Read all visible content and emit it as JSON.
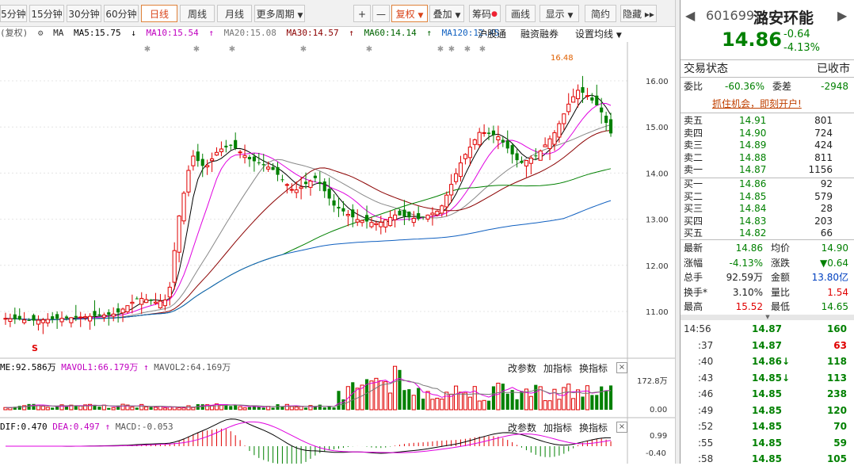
{
  "toolbar": {
    "periods": [
      "5分钟",
      "15分钟",
      "30分钟",
      "60分钟",
      "日线",
      "周线",
      "月线",
      "更多周期"
    ],
    "active_period": "日线",
    "plus": "+",
    "minus": "—",
    "fuquan": "复权",
    "diejia": "叠加",
    "chouma": "筹码",
    "huaxian": "画线",
    "xianshi": "显示",
    "jianyue": "简约",
    "yincang": "隐藏"
  },
  "ma_bar": {
    "fuquan_label": "(复权)",
    "ma_label": "MA",
    "ma5": "MA5:15.75",
    "ma10": "MA10:15.54",
    "ma20": "MA20:15.08",
    "ma30": "MA30:14.57",
    "ma60": "MA60:14.14",
    "ma120": "MA120:12.45",
    "hugutong": "沪股通",
    "rongzi": "融资融券",
    "shezhi": "设置均线"
  },
  "price_axis": [
    "16.00",
    "15.00",
    "14.00",
    "13.00",
    "12.00",
    "11.00"
  ],
  "high_label": "16.48",
  "s_marker": "S",
  "volume_panel": {
    "label": "ME:92.586万",
    "mavol1": "MAVOL1:66.179万",
    "mavol2": "MAVOL2:64.169万",
    "axis_top": "172.8万",
    "axis_bottom": "0.00",
    "gaicanshu": "改参数",
    "jiazhibiao": "加指标",
    "huanzhibiao": "换指标",
    "close": "×"
  },
  "macd_panel": {
    "dif": "DIF:0.470",
    "dea": "DEA:0.497",
    "macd": "MACD:-0.053",
    "axis_top": "0.99",
    "axis_bottom": "-0.40",
    "gaicanshu": "改参数",
    "jiazhibiao": "加指标",
    "huanzhibiao": "换指标",
    "close": "×"
  },
  "quote": {
    "code": "601699",
    "name": "潞安环能",
    "price": "14.86",
    "change": "-0.64",
    "change_pct": "-4.13%",
    "status_label": "交易状态",
    "status_value": "已收市",
    "weibi_label": "委比",
    "weibi_value": "-60.36%",
    "weicha_label": "委差",
    "weicha_value": "-2948",
    "promo": "抓住机会，即刻开户!",
    "asks": [
      {
        "label": "卖五",
        "price": "14.91",
        "vol": "801"
      },
      {
        "label": "卖四",
        "price": "14.90",
        "vol": "724"
      },
      {
        "label": "卖三",
        "price": "14.89",
        "vol": "424"
      },
      {
        "label": "卖二",
        "price": "14.88",
        "vol": "811"
      },
      {
        "label": "卖一",
        "price": "14.87",
        "vol": "1156"
      }
    ],
    "bids": [
      {
        "label": "买一",
        "price": "14.86",
        "vol": "92"
      },
      {
        "label": "买二",
        "price": "14.85",
        "vol": "579"
      },
      {
        "label": "买三",
        "price": "14.84",
        "vol": "28"
      },
      {
        "label": "买四",
        "price": "14.83",
        "vol": "203"
      },
      {
        "label": "买五",
        "price": "14.82",
        "vol": "66"
      }
    ],
    "stats": [
      {
        "l1": "最新",
        "v1": "14.86",
        "l2": "均价",
        "v2": "14.90"
      },
      {
        "l1": "涨幅",
        "v1": "-4.13%",
        "l2": "涨跌",
        "v2": "▼0.64"
      },
      {
        "l1": "总手",
        "v1": "92.59万",
        "l2": "金额",
        "v2": "13.80亿"
      },
      {
        "l1": "换手*",
        "v1": "3.10%",
        "l2": "量比",
        "v2": "1.54"
      },
      {
        "l1": "最高",
        "v1": "15.52",
        "l2": "最低",
        "v2": "14.65"
      }
    ],
    "ticks": [
      {
        "time": "14:56",
        "price": "14.87",
        "arrow": "",
        "vol": "160"
      },
      {
        "time": ":37",
        "price": "14.87",
        "arrow": "",
        "vol": "63"
      },
      {
        "time": ":40",
        "price": "14.86",
        "arrow": "↓",
        "vol": "118"
      },
      {
        "time": ":43",
        "price": "14.85",
        "arrow": "↓",
        "vol": "113"
      },
      {
        "time": ":46",
        "price": "14.85",
        "arrow": "",
        "vol": "238"
      },
      {
        "time": ":49",
        "price": "14.85",
        "arrow": "",
        "vol": "120"
      },
      {
        "time": ":52",
        "price": "14.85",
        "arrow": "",
        "vol": "70"
      },
      {
        "time": ":55",
        "price": "14.85",
        "arrow": "",
        "vol": "59"
      },
      {
        "time": ":58",
        "price": "14.85",
        "arrow": "",
        "vol": "105"
      }
    ]
  },
  "colors": {
    "up": "#e00000",
    "down": "#008000",
    "ma5": "#000000",
    "ma10": "#e000e0",
    "ma20": "#888888",
    "ma30": "#8b0000",
    "ma60": "#008000",
    "ma120": "#1060c0"
  }
}
